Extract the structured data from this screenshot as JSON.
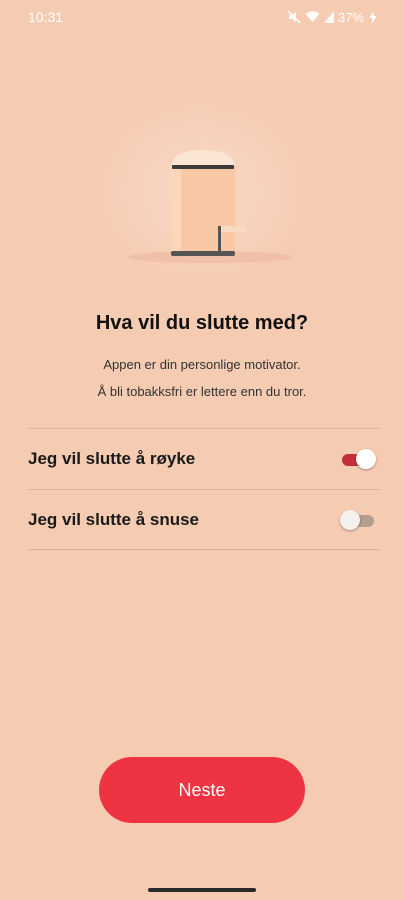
{
  "status_bar": {
    "time": "10:31",
    "battery": "37%",
    "icons": [
      "mute-icon",
      "wifi-icon",
      "signal-icon",
      "battery-charging-icon"
    ]
  },
  "hero": {
    "icon": "trash-bin-illustration"
  },
  "title": "Hva vil du slutte med?",
  "subtitle_lines": [
    "Appen er din personlige motivator.",
    "Å bli tobakksfri er lettere enn du tror."
  ],
  "options": [
    {
      "label": "Jeg vil slutte å røyke",
      "checked": true
    },
    {
      "label": "Jeg vil slutte å snuse",
      "checked": false
    }
  ],
  "next_button": {
    "label": "Neste"
  },
  "colors": {
    "background": "#f5cbb2",
    "accent": "#ee3443",
    "switch_on": "#c4303a"
  }
}
